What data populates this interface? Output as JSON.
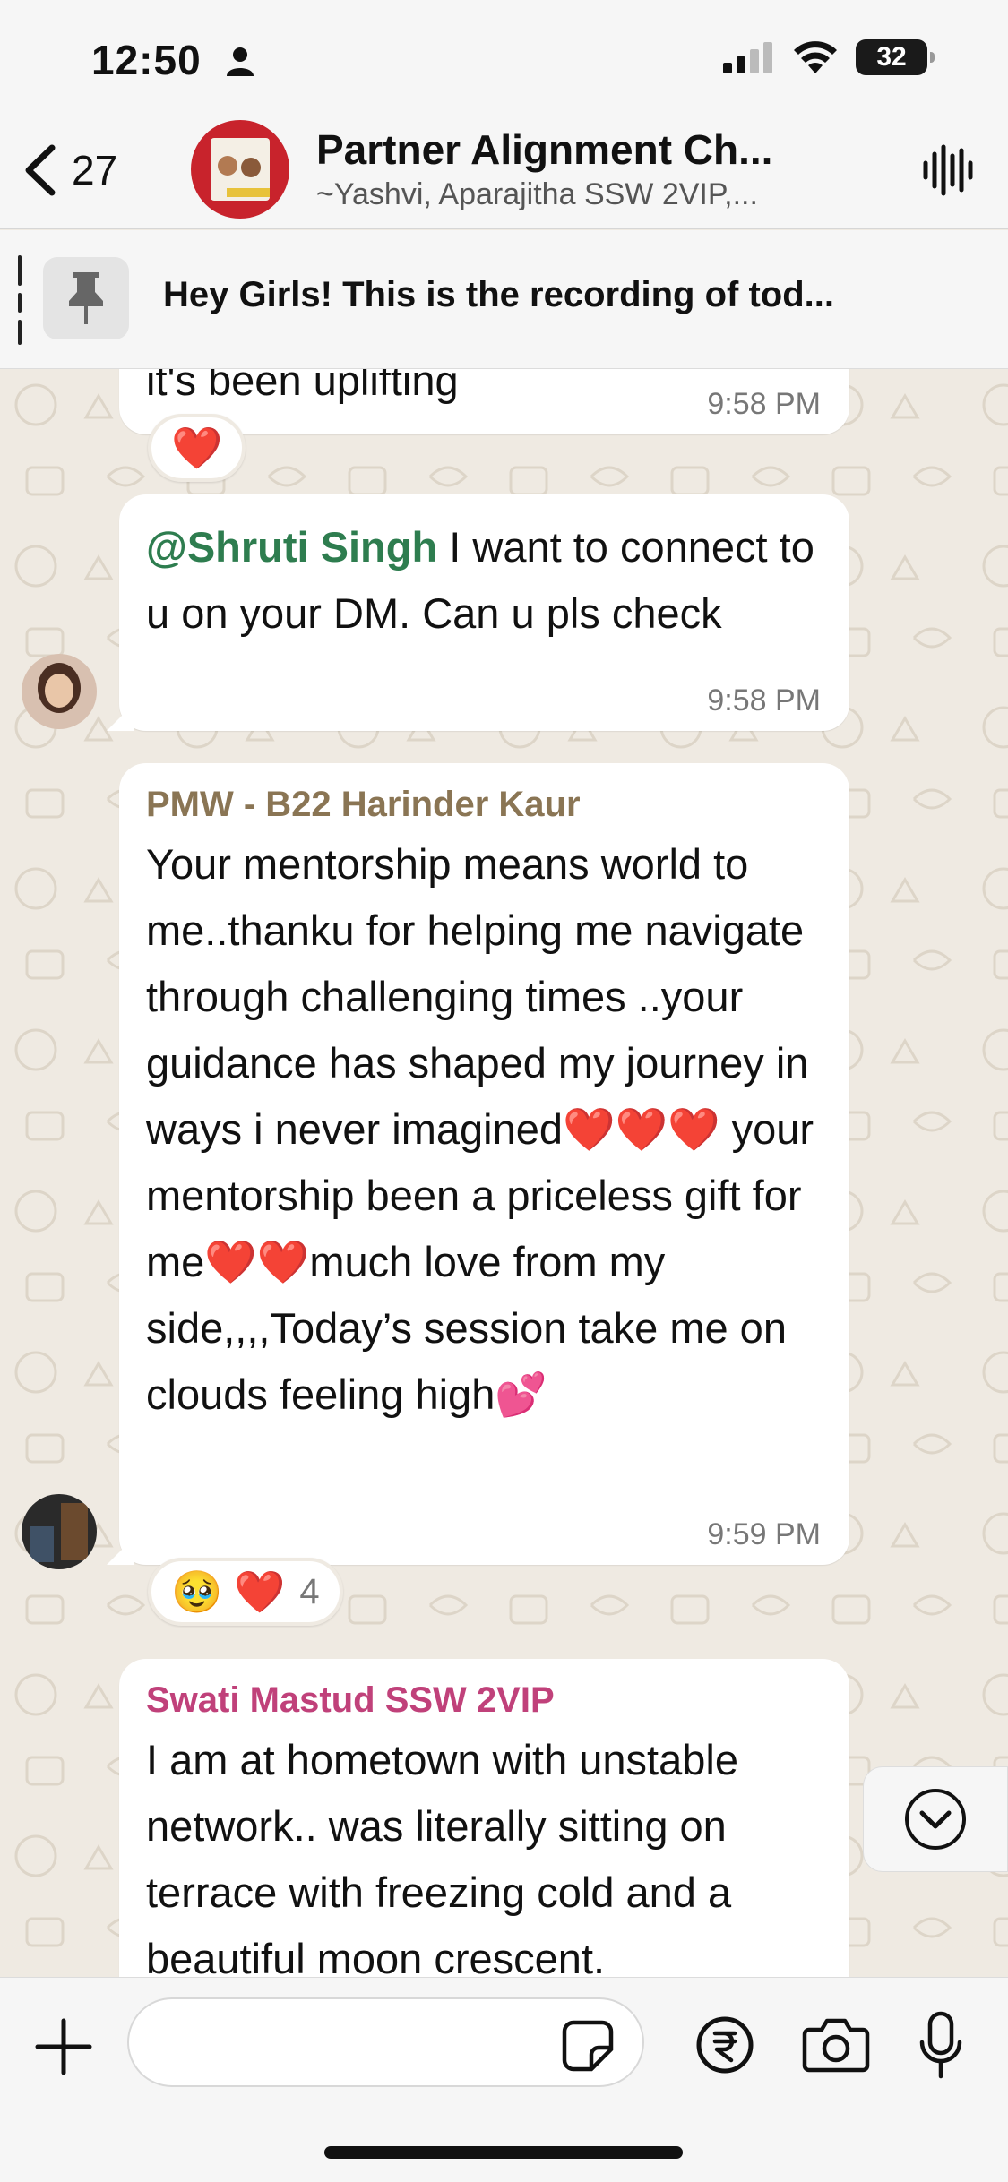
{
  "status_bar": {
    "time": "12:50",
    "battery": "32",
    "battery_level_percent": 32
  },
  "header": {
    "back_count": "27",
    "title": "Partner Alignment Ch...",
    "subtitle": "~Yashvi, Aparajitha SSW 2VIP,..."
  },
  "pinned": {
    "text": "Hey Girls! This is the recording of tod..."
  },
  "messages": [
    {
      "partial_text": "it's been uplifting",
      "time": "9:58 PM",
      "reaction": "❤️"
    },
    {
      "mention": "@Shruti Singh",
      "text": " I want to connect to u on your DM. Can u pls check",
      "time": "9:58 PM"
    },
    {
      "sender": "PMW - B22 Harinder Kaur",
      "sender_color": "#8a7554",
      "text": "Your mentorship means world to me..thanku for helping me navigate through challenging times ..your guidance has shaped my journey in ways i never imagined❤️❤️❤️ your mentorship been a priceless gift for me❤️❤️much love from my side,,,,Today’s session take me on clouds feeling high💕",
      "time": "9:59 PM",
      "reactions": "🥹 ❤️",
      "reaction_count": "4"
    },
    {
      "sender": "Swati Mastud SSW 2VIP",
      "sender_color": "#c0417a",
      "text": "I am at hometown with unstable network.. was literally sitting on terrace with freezing cold and a beautiful moon crescent."
    }
  ],
  "input": {
    "placeholder": ""
  },
  "icons": {
    "back": "chevron-left-icon",
    "voice": "waveform-icon",
    "pin": "pin-icon",
    "plus": "plus-icon",
    "sticker": "sticker-icon",
    "payment": "rupee-icon",
    "camera": "camera-icon",
    "mic": "microphone-icon",
    "scroll_down": "chevron-down-icon"
  }
}
